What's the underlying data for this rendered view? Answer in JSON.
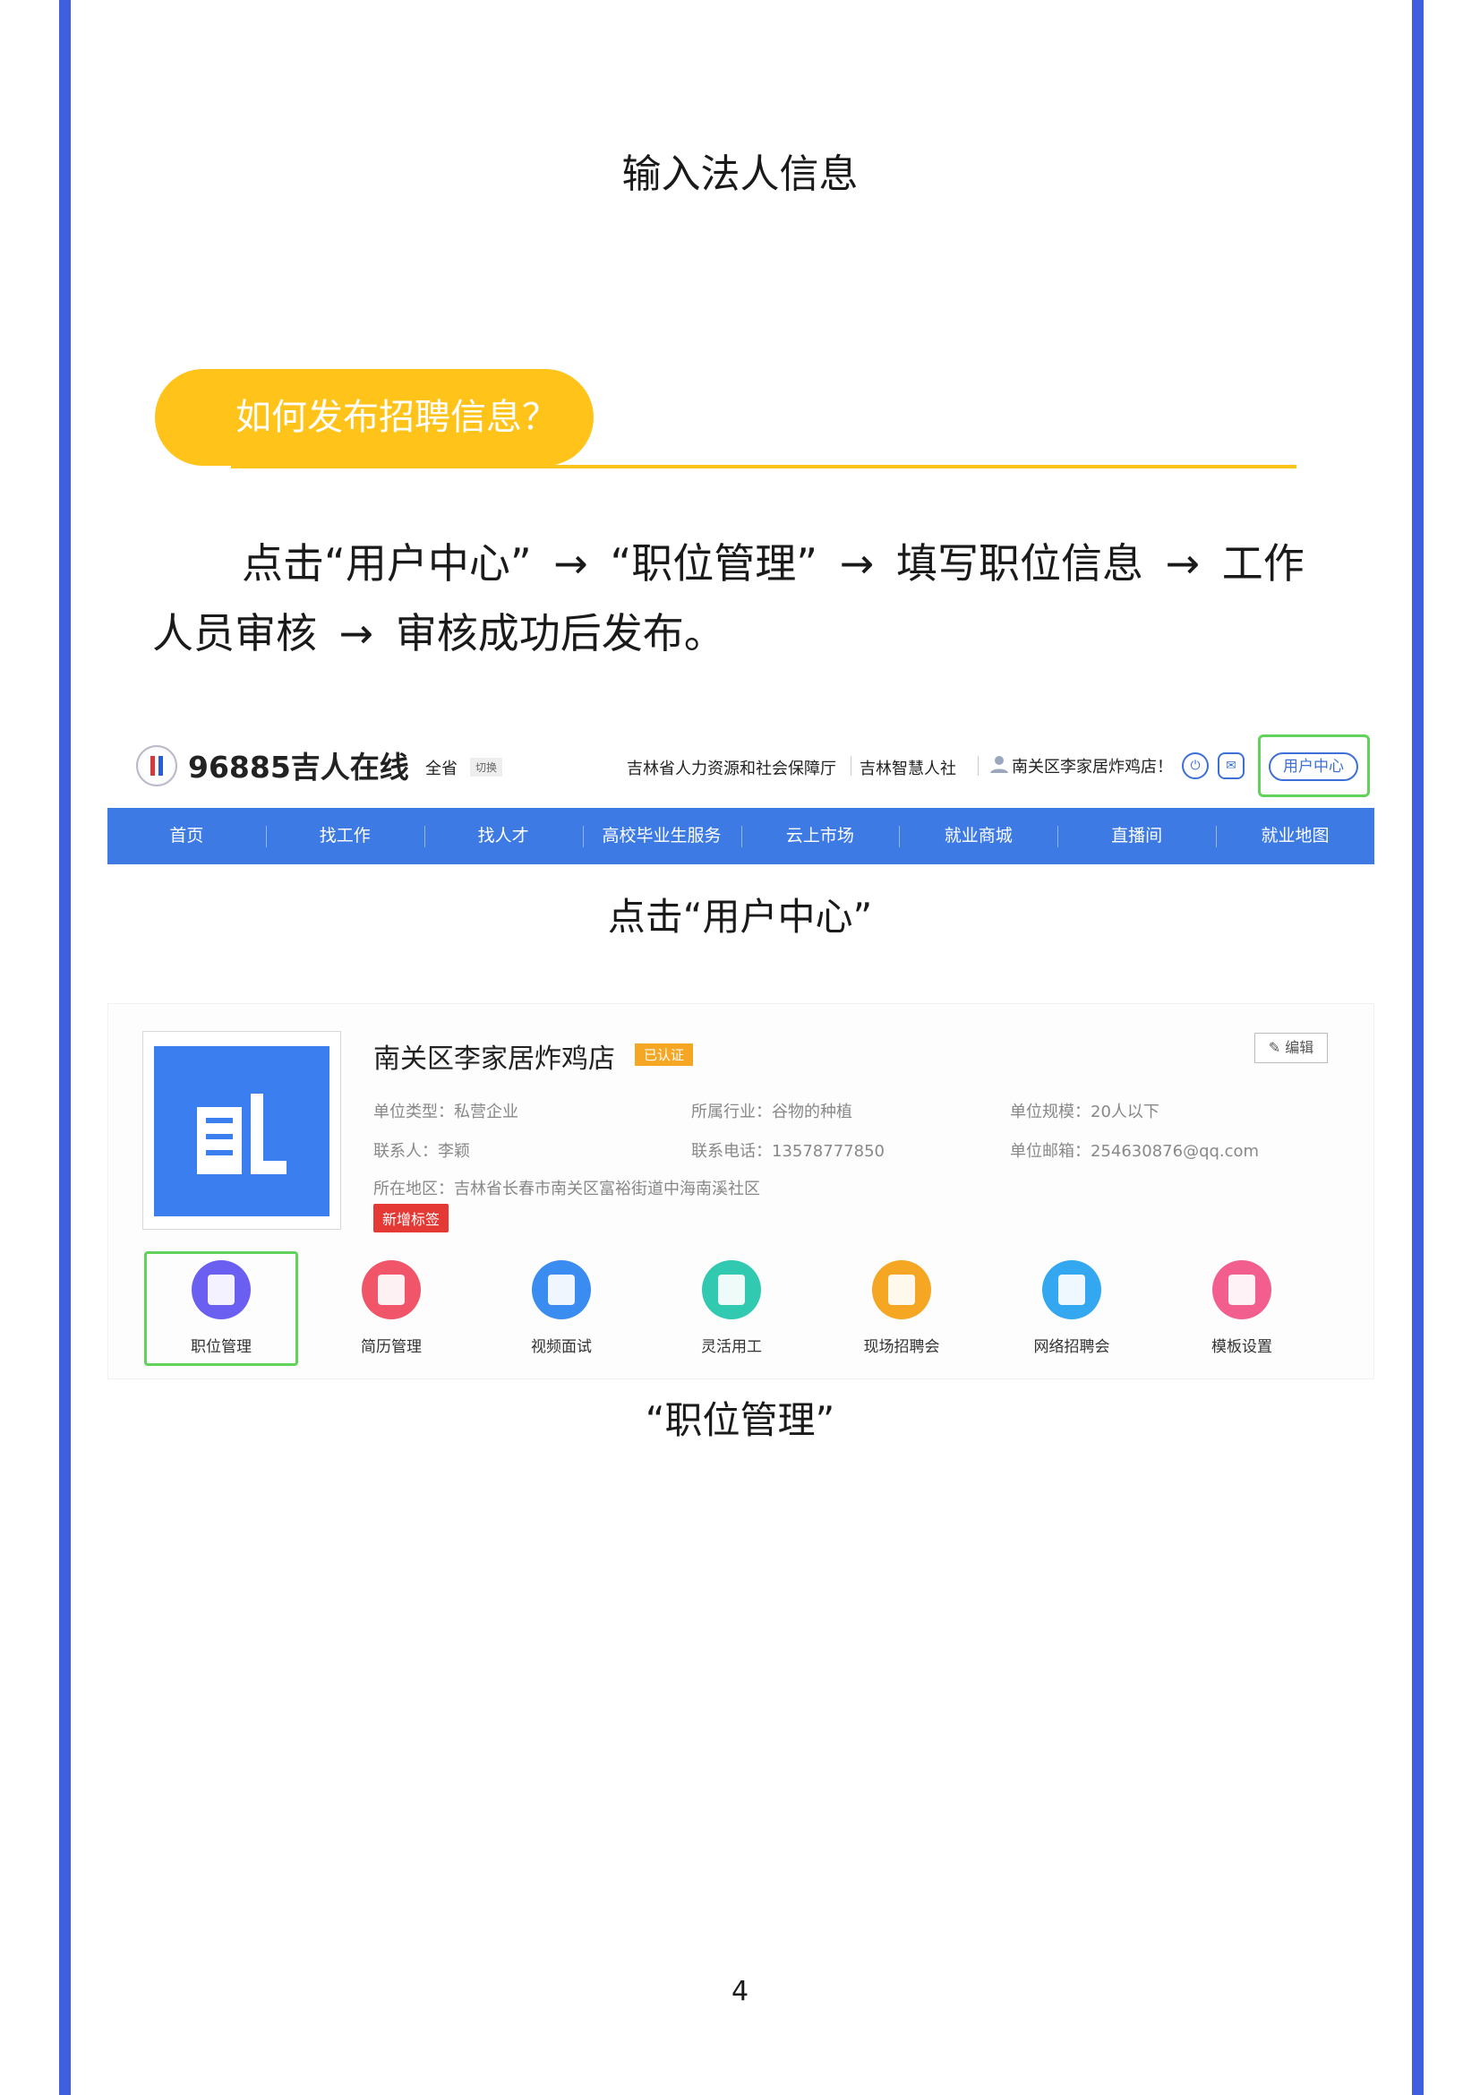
{
  "heading_top": "输入法人信息",
  "section_pill": "如何发布招聘信息？",
  "steps": {
    "s1": "点击“用户中心”",
    "s2": "“职位管理”",
    "s3": "填写职位信息",
    "s4": "工作",
    "s4b": "人员审核",
    "s5": "审核成功后发布。",
    "arrow": "→"
  },
  "site_header": {
    "logo_text": "96885吉人在线",
    "region": "全省",
    "switch": "切换",
    "gov_link": "吉林省人力资源和社会保障厅",
    "smart_link": "吉林智慧人社",
    "user_greeting": "南关区李家居炸鸡店！",
    "user_center": "用户中心"
  },
  "nav": [
    "首页",
    "找工作",
    "找人才",
    "高校毕业生服务",
    "云上市场",
    "就业商城",
    "直播间",
    "就业地图"
  ],
  "caption1": "点击“用户中心”",
  "company": {
    "name": "南关区李家居炸鸡店",
    "verified": "已认证",
    "edit": "编辑",
    "type": "单位类型：私营企业",
    "industry": "所属行业：谷物的种植",
    "scale": "单位规模：20人以下",
    "contact": "联系人：李颖",
    "phone": "联系电话：13578777850",
    "email": "单位邮箱：254630876@qq.com",
    "address": "所在地区：吉林省长春市南关区富裕街道中海南溪社区",
    "new_tag": "新增标签"
  },
  "menu_icons": [
    {
      "label": "职位管理",
      "color": "#6a5ff0",
      "icon": "briefcase-icon"
    },
    {
      "label": "简历管理",
      "color": "#f0556a",
      "icon": "resume-icon"
    },
    {
      "label": "视频面试",
      "color": "#3a8cf0",
      "icon": "video-icon"
    },
    {
      "label": "灵活用工",
      "color": "#31c9b0",
      "icon": "people-icon"
    },
    {
      "label": "现场招聘会",
      "color": "#f5a623",
      "icon": "building-icon"
    },
    {
      "label": "网络招聘会",
      "color": "#33a7f0",
      "icon": "browser-icon"
    },
    {
      "label": "模板设置",
      "color": "#f25e8e",
      "icon": "document-icon"
    }
  ],
  "caption2": "“职位管理”",
  "page_number": "4"
}
